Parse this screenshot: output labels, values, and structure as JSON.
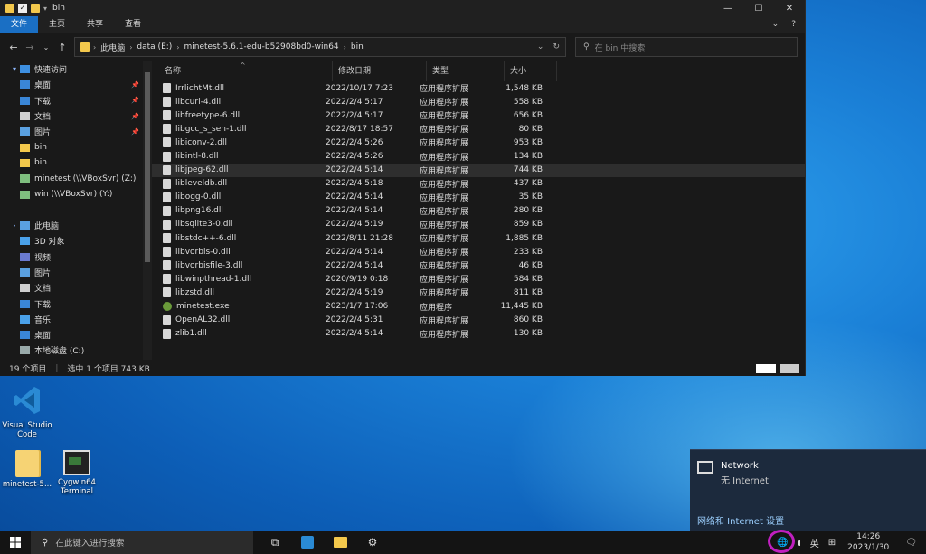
{
  "window": {
    "title": "bin",
    "controls": [
      "—",
      "☐",
      "✕"
    ]
  },
  "ribbon": {
    "tabs": [
      "文件",
      "主页",
      "共享",
      "查看"
    ]
  },
  "address": {
    "crumbs": [
      "此电脑",
      "data (E:)",
      "minetest-5.6.1-edu-b52908bd0-win64",
      "bin"
    ]
  },
  "search": {
    "placeholder": "在 bin 中搜索"
  },
  "navpane": {
    "items": [
      {
        "label": "快速访问",
        "icon": "star-icon",
        "expanded": true,
        "level": 0
      },
      {
        "label": "桌面",
        "icon": "desktop-icon",
        "pinned": true,
        "level": 1
      },
      {
        "label": "下载",
        "icon": "download-icon",
        "pinned": true,
        "level": 1
      },
      {
        "label": "文档",
        "icon": "document-icon",
        "pinned": true,
        "level": 1
      },
      {
        "label": "图片",
        "icon": "picture-icon",
        "pinned": true,
        "level": 1
      },
      {
        "label": "bin",
        "icon": "folder-icon",
        "level": 1
      },
      {
        "label": "bin",
        "icon": "folder-icon",
        "level": 1
      },
      {
        "label": "minetest (\\\\VBoxSvr) (Z:)",
        "icon": "network-drive-icon",
        "level": 1
      },
      {
        "label": "win (\\\\VBoxSvr) (Y:)",
        "icon": "network-drive-icon",
        "level": 1
      },
      {
        "label": "",
        "icon": "",
        "level": 0
      },
      {
        "label": "此电脑",
        "icon": "computer-icon",
        "level": 0
      },
      {
        "label": "3D 对象",
        "icon": "3d-icon",
        "level": 1
      },
      {
        "label": "视频",
        "icon": "video-icon",
        "level": 1
      },
      {
        "label": "图片",
        "icon": "picture-icon",
        "level": 1
      },
      {
        "label": "文档",
        "icon": "document-icon",
        "level": 1
      },
      {
        "label": "下载",
        "icon": "download-icon",
        "level": 1
      },
      {
        "label": "音乐",
        "icon": "music-icon",
        "level": 1
      },
      {
        "label": "桌面",
        "icon": "desktop-icon",
        "level": 1
      },
      {
        "label": "本地磁盘 (C:)",
        "icon": "disk-icon",
        "level": 1
      }
    ]
  },
  "columns": [
    "名称",
    "修改日期",
    "类型",
    "大小"
  ],
  "files": [
    {
      "name": "IrrlichtMt.dll",
      "date": "2022/10/17 7:23",
      "type": "应用程序扩展",
      "size": "1,548 KB"
    },
    {
      "name": "libcurl-4.dll",
      "date": "2022/2/4 5:17",
      "type": "应用程序扩展",
      "size": "558 KB"
    },
    {
      "name": "libfreetype-6.dll",
      "date": "2022/2/4 5:17",
      "type": "应用程序扩展",
      "size": "656 KB"
    },
    {
      "name": "libgcc_s_seh-1.dll",
      "date": "2022/8/17 18:57",
      "type": "应用程序扩展",
      "size": "80 KB"
    },
    {
      "name": "libiconv-2.dll",
      "date": "2022/2/4 5:26",
      "type": "应用程序扩展",
      "size": "953 KB"
    },
    {
      "name": "libintl-8.dll",
      "date": "2022/2/4 5:26",
      "type": "应用程序扩展",
      "size": "134 KB"
    },
    {
      "name": "libjpeg-62.dll",
      "date": "2022/2/4 5:14",
      "type": "应用程序扩展",
      "size": "744 KB",
      "selected": true
    },
    {
      "name": "libleveldb.dll",
      "date": "2022/2/4 5:18",
      "type": "应用程序扩展",
      "size": "437 KB"
    },
    {
      "name": "libogg-0.dll",
      "date": "2022/2/4 5:14",
      "type": "应用程序扩展",
      "size": "35 KB"
    },
    {
      "name": "libpng16.dll",
      "date": "2022/2/4 5:14",
      "type": "应用程序扩展",
      "size": "280 KB"
    },
    {
      "name": "libsqlite3-0.dll",
      "date": "2022/2/4 5:19",
      "type": "应用程序扩展",
      "size": "859 KB"
    },
    {
      "name": "libstdc++-6.dll",
      "date": "2022/8/11 21:28",
      "type": "应用程序扩展",
      "size": "1,885 KB"
    },
    {
      "name": "libvorbis-0.dll",
      "date": "2022/2/4 5:14",
      "type": "应用程序扩展",
      "size": "233 KB"
    },
    {
      "name": "libvorbisfile-3.dll",
      "date": "2022/2/4 5:14",
      "type": "应用程序扩展",
      "size": "46 KB"
    },
    {
      "name": "libwinpthread-1.dll",
      "date": "2020/9/19 0:18",
      "type": "应用程序扩展",
      "size": "584 KB"
    },
    {
      "name": "libzstd.dll",
      "date": "2022/2/4 5:19",
      "type": "应用程序扩展",
      "size": "811 KB"
    },
    {
      "name": "minetest.exe",
      "date": "2023/1/7 17:06",
      "type": "应用程序",
      "size": "11,445 KB",
      "exe": true
    },
    {
      "name": "OpenAL32.dll",
      "date": "2022/2/4 5:31",
      "type": "应用程序扩展",
      "size": "860 KB"
    },
    {
      "name": "zlib1.dll",
      "date": "2022/2/4 5:14",
      "type": "应用程序扩展",
      "size": "130 KB"
    }
  ],
  "status": {
    "count": "19 个项目",
    "selection": "选中 1 个项目  743 KB"
  },
  "desktop": {
    "vscode_label": "Visual Studio Code",
    "minetest_label": "minetest-5...",
    "cygwin_label": "Cygwin64 Terminal"
  },
  "network_flyout": {
    "title": "Network",
    "status": "无 Internet",
    "settings_link": "网络和 Internet 设置"
  },
  "taskbar": {
    "search_placeholder": "在此键入进行搜索",
    "ime": "英",
    "time": "14:26",
    "date": "2023/1/30"
  }
}
